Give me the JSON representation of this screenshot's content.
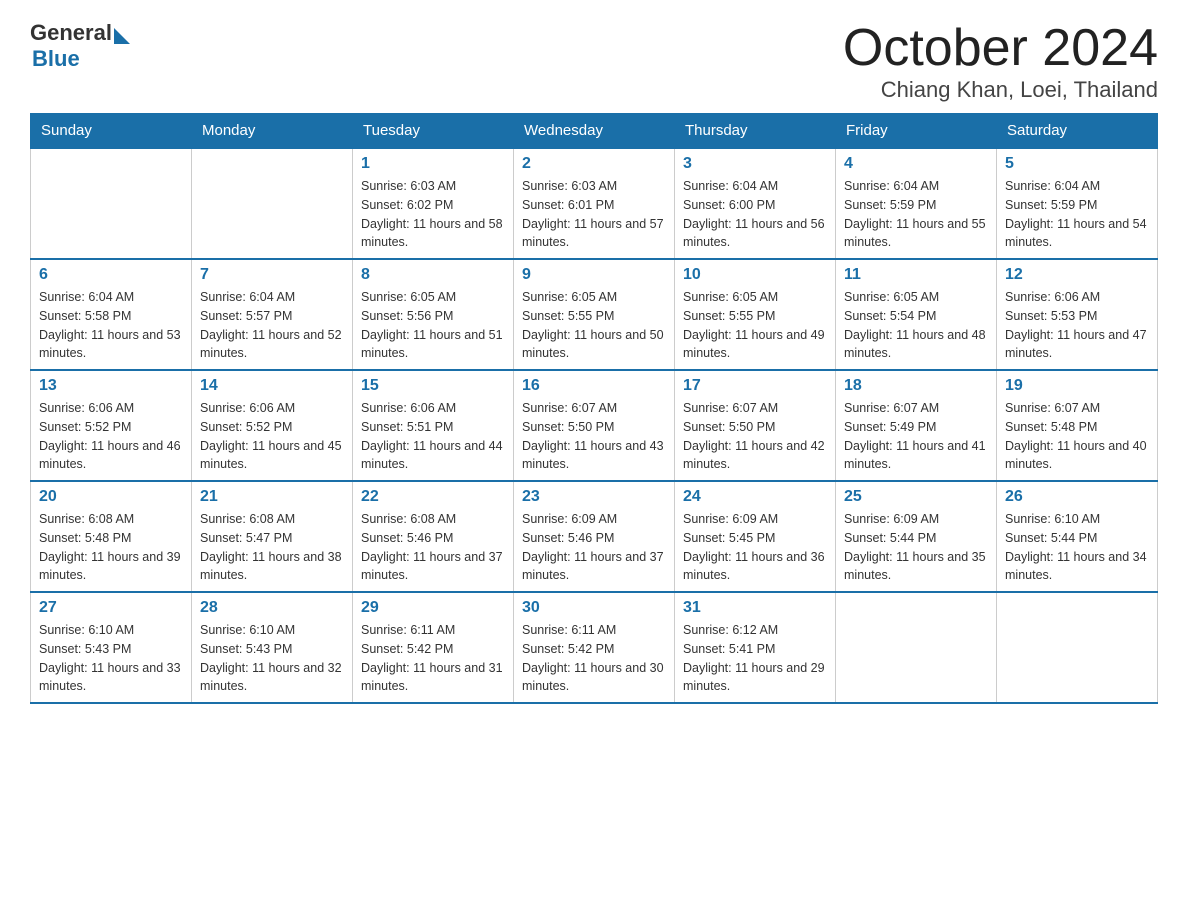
{
  "header": {
    "logo_general": "General",
    "logo_blue": "Blue",
    "month_title": "October 2024",
    "location": "Chiang Khan, Loei, Thailand"
  },
  "days_of_week": [
    "Sunday",
    "Monday",
    "Tuesday",
    "Wednesday",
    "Thursday",
    "Friday",
    "Saturday"
  ],
  "weeks": [
    [
      {
        "day": "",
        "sunrise": "",
        "sunset": "",
        "daylight": ""
      },
      {
        "day": "",
        "sunrise": "",
        "sunset": "",
        "daylight": ""
      },
      {
        "day": "1",
        "sunrise": "Sunrise: 6:03 AM",
        "sunset": "Sunset: 6:02 PM",
        "daylight": "Daylight: 11 hours and 58 minutes."
      },
      {
        "day": "2",
        "sunrise": "Sunrise: 6:03 AM",
        "sunset": "Sunset: 6:01 PM",
        "daylight": "Daylight: 11 hours and 57 minutes."
      },
      {
        "day": "3",
        "sunrise": "Sunrise: 6:04 AM",
        "sunset": "Sunset: 6:00 PM",
        "daylight": "Daylight: 11 hours and 56 minutes."
      },
      {
        "day": "4",
        "sunrise": "Sunrise: 6:04 AM",
        "sunset": "Sunset: 5:59 PM",
        "daylight": "Daylight: 11 hours and 55 minutes."
      },
      {
        "day": "5",
        "sunrise": "Sunrise: 6:04 AM",
        "sunset": "Sunset: 5:59 PM",
        "daylight": "Daylight: 11 hours and 54 minutes."
      }
    ],
    [
      {
        "day": "6",
        "sunrise": "Sunrise: 6:04 AM",
        "sunset": "Sunset: 5:58 PM",
        "daylight": "Daylight: 11 hours and 53 minutes."
      },
      {
        "day": "7",
        "sunrise": "Sunrise: 6:04 AM",
        "sunset": "Sunset: 5:57 PM",
        "daylight": "Daylight: 11 hours and 52 minutes."
      },
      {
        "day": "8",
        "sunrise": "Sunrise: 6:05 AM",
        "sunset": "Sunset: 5:56 PM",
        "daylight": "Daylight: 11 hours and 51 minutes."
      },
      {
        "day": "9",
        "sunrise": "Sunrise: 6:05 AM",
        "sunset": "Sunset: 5:55 PM",
        "daylight": "Daylight: 11 hours and 50 minutes."
      },
      {
        "day": "10",
        "sunrise": "Sunrise: 6:05 AM",
        "sunset": "Sunset: 5:55 PM",
        "daylight": "Daylight: 11 hours and 49 minutes."
      },
      {
        "day": "11",
        "sunrise": "Sunrise: 6:05 AM",
        "sunset": "Sunset: 5:54 PM",
        "daylight": "Daylight: 11 hours and 48 minutes."
      },
      {
        "day": "12",
        "sunrise": "Sunrise: 6:06 AM",
        "sunset": "Sunset: 5:53 PM",
        "daylight": "Daylight: 11 hours and 47 minutes."
      }
    ],
    [
      {
        "day": "13",
        "sunrise": "Sunrise: 6:06 AM",
        "sunset": "Sunset: 5:52 PM",
        "daylight": "Daylight: 11 hours and 46 minutes."
      },
      {
        "day": "14",
        "sunrise": "Sunrise: 6:06 AM",
        "sunset": "Sunset: 5:52 PM",
        "daylight": "Daylight: 11 hours and 45 minutes."
      },
      {
        "day": "15",
        "sunrise": "Sunrise: 6:06 AM",
        "sunset": "Sunset: 5:51 PM",
        "daylight": "Daylight: 11 hours and 44 minutes."
      },
      {
        "day": "16",
        "sunrise": "Sunrise: 6:07 AM",
        "sunset": "Sunset: 5:50 PM",
        "daylight": "Daylight: 11 hours and 43 minutes."
      },
      {
        "day": "17",
        "sunrise": "Sunrise: 6:07 AM",
        "sunset": "Sunset: 5:50 PM",
        "daylight": "Daylight: 11 hours and 42 minutes."
      },
      {
        "day": "18",
        "sunrise": "Sunrise: 6:07 AM",
        "sunset": "Sunset: 5:49 PM",
        "daylight": "Daylight: 11 hours and 41 minutes."
      },
      {
        "day": "19",
        "sunrise": "Sunrise: 6:07 AM",
        "sunset": "Sunset: 5:48 PM",
        "daylight": "Daylight: 11 hours and 40 minutes."
      }
    ],
    [
      {
        "day": "20",
        "sunrise": "Sunrise: 6:08 AM",
        "sunset": "Sunset: 5:48 PM",
        "daylight": "Daylight: 11 hours and 39 minutes."
      },
      {
        "day": "21",
        "sunrise": "Sunrise: 6:08 AM",
        "sunset": "Sunset: 5:47 PM",
        "daylight": "Daylight: 11 hours and 38 minutes."
      },
      {
        "day": "22",
        "sunrise": "Sunrise: 6:08 AM",
        "sunset": "Sunset: 5:46 PM",
        "daylight": "Daylight: 11 hours and 37 minutes."
      },
      {
        "day": "23",
        "sunrise": "Sunrise: 6:09 AM",
        "sunset": "Sunset: 5:46 PM",
        "daylight": "Daylight: 11 hours and 37 minutes."
      },
      {
        "day": "24",
        "sunrise": "Sunrise: 6:09 AM",
        "sunset": "Sunset: 5:45 PM",
        "daylight": "Daylight: 11 hours and 36 minutes."
      },
      {
        "day": "25",
        "sunrise": "Sunrise: 6:09 AM",
        "sunset": "Sunset: 5:44 PM",
        "daylight": "Daylight: 11 hours and 35 minutes."
      },
      {
        "day": "26",
        "sunrise": "Sunrise: 6:10 AM",
        "sunset": "Sunset: 5:44 PM",
        "daylight": "Daylight: 11 hours and 34 minutes."
      }
    ],
    [
      {
        "day": "27",
        "sunrise": "Sunrise: 6:10 AM",
        "sunset": "Sunset: 5:43 PM",
        "daylight": "Daylight: 11 hours and 33 minutes."
      },
      {
        "day": "28",
        "sunrise": "Sunrise: 6:10 AM",
        "sunset": "Sunset: 5:43 PM",
        "daylight": "Daylight: 11 hours and 32 minutes."
      },
      {
        "day": "29",
        "sunrise": "Sunrise: 6:11 AM",
        "sunset": "Sunset: 5:42 PM",
        "daylight": "Daylight: 11 hours and 31 minutes."
      },
      {
        "day": "30",
        "sunrise": "Sunrise: 6:11 AM",
        "sunset": "Sunset: 5:42 PM",
        "daylight": "Daylight: 11 hours and 30 minutes."
      },
      {
        "day": "31",
        "sunrise": "Sunrise: 6:12 AM",
        "sunset": "Sunset: 5:41 PM",
        "daylight": "Daylight: 11 hours and 29 minutes."
      },
      {
        "day": "",
        "sunrise": "",
        "sunset": "",
        "daylight": ""
      },
      {
        "day": "",
        "sunrise": "",
        "sunset": "",
        "daylight": ""
      }
    ]
  ]
}
